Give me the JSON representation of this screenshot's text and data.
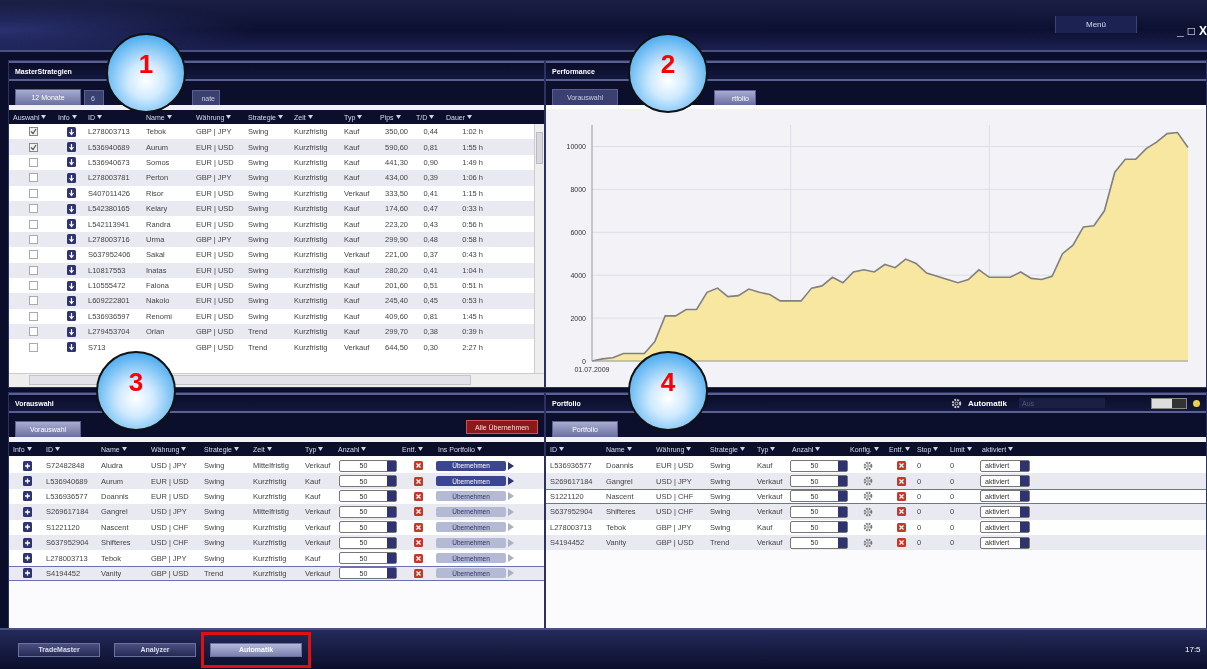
{
  "window": {
    "menu": "Menü",
    "controls": [
      "_",
      "□",
      "X"
    ]
  },
  "callouts": [
    "1",
    "2",
    "3",
    "4"
  ],
  "master": {
    "title": "MasterStrategien",
    "tabs": [
      {
        "label": "12 Monate",
        "selected": true
      },
      {
        "label": "6",
        "selected": false
      },
      {
        "label": "nate",
        "selected": false
      }
    ],
    "columns": [
      "Auswahl",
      "Info",
      "ID",
      "Name",
      "Währung",
      "Strategie",
      "Zeit",
      "Typ",
      "Pips",
      "T/D",
      "Dauer"
    ],
    "rows": [
      {
        "checked": true,
        "id": "L278003713",
        "name": "Tebok",
        "currency": "GBP | JPY",
        "strategy": "Swing",
        "term": "Kurzfristig",
        "type": "Kauf",
        "pips": "350,00",
        "td": "0,44",
        "duration": "1:02 h"
      },
      {
        "checked": true,
        "id": "L536940689",
        "name": "Aurum",
        "currency": "EUR | USD",
        "strategy": "Swing",
        "term": "Kurzfristig",
        "type": "Kauf",
        "pips": "590,60",
        "td": "0,81",
        "duration": "1:55 h"
      },
      {
        "checked": false,
        "id": "L536940673",
        "name": "Somos",
        "currency": "EUR | USD",
        "strategy": "Swing",
        "term": "Kurzfristig",
        "type": "Kauf",
        "pips": "441,30",
        "td": "0,90",
        "duration": "1:49 h"
      },
      {
        "checked": false,
        "id": "L278003781",
        "name": "Perton",
        "currency": "GBP | JPY",
        "strategy": "Swing",
        "term": "Kurzfristig",
        "type": "Kauf",
        "pips": "434,00",
        "td": "0,39",
        "duration": "1:06 h"
      },
      {
        "checked": false,
        "id": "S407011426",
        "name": "Risor",
        "currency": "EUR | USD",
        "strategy": "Swing",
        "term": "Kurzfristig",
        "type": "Verkauf",
        "pips": "333,50",
        "td": "0,41",
        "duration": "1:15 h"
      },
      {
        "checked": false,
        "id": "L542380165",
        "name": "Kelary",
        "currency": "EUR | USD",
        "strategy": "Swing",
        "term": "Kurzfristig",
        "type": "Kauf",
        "pips": "174,60",
        "td": "0,47",
        "duration": "0:33 h"
      },
      {
        "checked": false,
        "id": "L542113941",
        "name": "Randra",
        "currency": "EUR | USD",
        "strategy": "Swing",
        "term": "Kurzfristig",
        "type": "Kauf",
        "pips": "223,20",
        "td": "0,43",
        "duration": "0:56 h"
      },
      {
        "checked": false,
        "id": "L278003716",
        "name": "Urma",
        "currency": "GBP | JPY",
        "strategy": "Swing",
        "term": "Kurzfristig",
        "type": "Kauf",
        "pips": "299,90",
        "td": "0,48",
        "duration": "0:58 h"
      },
      {
        "checked": false,
        "id": "S637952406",
        "name": "Sakal",
        "currency": "EUR | USD",
        "strategy": "Swing",
        "term": "Kurzfristig",
        "type": "Verkauf",
        "pips": "221,00",
        "td": "0,37",
        "duration": "0:43 h"
      },
      {
        "checked": false,
        "id": "L10817553",
        "name": "Inatas",
        "currency": "EUR | USD",
        "strategy": "Swing",
        "term": "Kurzfristig",
        "type": "Kauf",
        "pips": "280,20",
        "td": "0,41",
        "duration": "1:04 h"
      },
      {
        "checked": false,
        "id": "L10555472",
        "name": "Falona",
        "currency": "EUR | USD",
        "strategy": "Swing",
        "term": "Kurzfristig",
        "type": "Kauf",
        "pips": "201,60",
        "td": "0,51",
        "duration": "0:51 h"
      },
      {
        "checked": false,
        "id": "L609222801",
        "name": "Nakolo",
        "currency": "EUR | USD",
        "strategy": "Swing",
        "term": "Kurzfristig",
        "type": "Kauf",
        "pips": "245,40",
        "td": "0,45",
        "duration": "0:53 h"
      },
      {
        "checked": false,
        "id": "L536936597",
        "name": "Renomi",
        "currency": "EUR | USD",
        "strategy": "Swing",
        "term": "Kurzfristig",
        "type": "Kauf",
        "pips": "409,60",
        "td": "0,81",
        "duration": "1:45 h"
      },
      {
        "checked": false,
        "id": "L279453704",
        "name": "Orlan",
        "currency": "GBP | USD",
        "strategy": "Trend",
        "term": "Kurzfristig",
        "type": "Kauf",
        "pips": "299,70",
        "td": "0,38",
        "duration": "0:39 h"
      },
      {
        "checked": false,
        "id": "S713",
        "currency": "GBP | USD",
        "strategy": "Trend",
        "term": "Kurzfristig",
        "type": "Verkauf",
        "pips": "644,50",
        "td": "0,30",
        "duration": "2:27 h"
      }
    ]
  },
  "performance": {
    "title": "Performance",
    "tabs": [
      {
        "label": "Vorauswahl",
        "selected": false
      },
      {
        "label": "rtfolio",
        "selected": true
      }
    ],
    "chart_data": {
      "type": "area",
      "grid": true,
      "ylim": [
        0,
        11000
      ],
      "yticks": [
        0,
        2000,
        4000,
        6000,
        8000,
        10000
      ],
      "categories": [
        "01.07.2009",
        null,
        null,
        null,
        null,
        null,
        null,
        null,
        null,
        null,
        null,
        null,
        null,
        null,
        null,
        null,
        null,
        null,
        null,
        null,
        null,
        null,
        null,
        null,
        null,
        null,
        null,
        null,
        null,
        null,
        null,
        null,
        null,
        null,
        null,
        null,
        null,
        null,
        null,
        null,
        null,
        null,
        null,
        null,
        null,
        null,
        null,
        null,
        null,
        null,
        null,
        null,
        null,
        null,
        null,
        null,
        null,
        null
      ],
      "series": [
        {
          "color": "#f7e7a0",
          "values": [
            0,
            100,
            150,
            350,
            350,
            350,
            900,
            2100,
            2100,
            2400,
            2400,
            3200,
            3400,
            3000,
            3050,
            3350,
            3200,
            3100,
            2800,
            2800,
            2800,
            3400,
            3500,
            3900,
            3650,
            4150,
            4250,
            4150,
            4500,
            4350,
            4750,
            4550,
            4100,
            3950,
            3800,
            3650,
            3800,
            4250,
            3900,
            3900,
            3900,
            4150,
            3850,
            3800,
            3950,
            5000,
            5400,
            6250,
            6300,
            7000,
            8800,
            9400,
            9400,
            9900,
            10200,
            10600,
            10650,
            9950
          ]
        }
      ]
    }
  },
  "preselection": {
    "title": "Vorauswahl",
    "tabs": [
      {
        "label": "Vorauswahl",
        "selected": true
      }
    ],
    "accept_all": "Alle Übernehmen",
    "columns": [
      "Info",
      "ID",
      "Name",
      "Währung",
      "Strategie",
      "Zeit",
      "Typ",
      "Anzahl",
      "Entf.",
      "Ins Portfolio"
    ],
    "rows": [
      {
        "selected": false,
        "enabled": true,
        "id": "S72482848",
        "name": "Aludra",
        "currency": "USD | JPY",
        "strategy": "Swing",
        "term": "Mittelfristig",
        "type": "Verkauf",
        "quantity": "50",
        "button": "Übernehmen"
      },
      {
        "selected": false,
        "enabled": true,
        "id": "L536940689",
        "name": "Aurum",
        "currency": "EUR | USD",
        "strategy": "Swing",
        "term": "Kurzfristig",
        "type": "Kauf",
        "quantity": "50",
        "button": "Übernehmen"
      },
      {
        "selected": false,
        "enabled": false,
        "id": "L536936577",
        "name": "Doannis",
        "currency": "EUR | USD",
        "strategy": "Swing",
        "term": "Kurzfristig",
        "type": "Kauf",
        "quantity": "50",
        "button": "Übernehmen"
      },
      {
        "selected": false,
        "enabled": false,
        "id": "S269617184",
        "name": "Gangrel",
        "currency": "USD | JPY",
        "strategy": "Swing",
        "term": "Mittelfristig",
        "type": "Verkauf",
        "quantity": "50",
        "button": "Übernehmen"
      },
      {
        "selected": false,
        "enabled": false,
        "id": "S1221120",
        "name": "Nascent",
        "currency": "USD | CHF",
        "strategy": "Swing",
        "term": "Kurzfristig",
        "type": "Verkauf",
        "quantity": "50",
        "button": "Übernehmen"
      },
      {
        "selected": false,
        "enabled": false,
        "id": "S637952904",
        "name": "Shifteres",
        "currency": "USD | CHF",
        "strategy": "Swing",
        "term": "Kurzfristig",
        "type": "Verkauf",
        "quantity": "50",
        "button": "Übernehmen"
      },
      {
        "selected": false,
        "enabled": false,
        "id": "L278003713",
        "name": "Tebok",
        "currency": "GBP | JPY",
        "strategy": "Swing",
        "term": "Kurzfristig",
        "type": "Kauf",
        "quantity": "50",
        "button": "Übernehmen"
      },
      {
        "selected": true,
        "enabled": false,
        "id": "S4194452",
        "name": "Vanity",
        "currency": "GBP | USD",
        "strategy": "Trend",
        "term": "Kurzfristig",
        "type": "Verkauf",
        "quantity": "50",
        "button": "Übernehmen"
      }
    ]
  },
  "portfolio": {
    "title": "Portfolio",
    "automation_label": "Automatik",
    "automation_field": {
      "placeholder": "Aus"
    },
    "automation_toggle": {
      "on": true
    },
    "tabs": [
      {
        "label": "Portfolio",
        "selected": true
      }
    ],
    "columns": [
      "ID",
      "Name",
      "Währung",
      "Strategie",
      "Typ",
      "Anzahl",
      "Konfig.",
      "Entf.",
      "Stop",
      "Limit",
      "aktiviert"
    ],
    "rows": [
      {
        "selected": false,
        "id": "L536936577",
        "name": "Doannis",
        "currency": "EUR | USD",
        "strategy": "Swing",
        "type": "Kauf",
        "quantity": "50",
        "stop": "0",
        "limit": "0",
        "activation": "aktiviert"
      },
      {
        "selected": false,
        "id": "S269617184",
        "name": "Gangrel",
        "currency": "USD | JPY",
        "strategy": "Swing",
        "type": "Verkauf",
        "quantity": "50",
        "stop": "0",
        "limit": "0",
        "activation": "aktiviert"
      },
      {
        "selected": true,
        "id": "S1221120",
        "name": "Nascent",
        "currency": "USD | CHF",
        "strategy": "Swing",
        "type": "Verkauf",
        "quantity": "50",
        "stop": "0",
        "limit": "0",
        "activation": "aktiviert"
      },
      {
        "selected": false,
        "id": "S637952904",
        "name": "Shifteres",
        "currency": "USD | CHF",
        "strategy": "Swing",
        "type": "Verkauf",
        "quantity": "50",
        "stop": "0",
        "limit": "0",
        "activation": "aktiviert"
      },
      {
        "selected": false,
        "id": "L278003713",
        "name": "Tebok",
        "currency": "GBP | JPY",
        "strategy": "Swing",
        "type": "Kauf",
        "quantity": "50",
        "stop": "0",
        "limit": "0",
        "activation": "aktiviert"
      },
      {
        "selected": false,
        "id": "S4194452",
        "name": "Vanity",
        "currency": "GBP | USD",
        "strategy": "Trend",
        "type": "Verkauf",
        "quantity": "50",
        "stop": "0",
        "limit": "0",
        "activation": "aktiviert"
      }
    ]
  },
  "taskbar": {
    "buttons": [
      {
        "label": "TradeMaster",
        "selected": false,
        "highlighted": false
      },
      {
        "label": "Analyzer",
        "selected": false,
        "highlighted": false
      },
      {
        "label": "Automatik",
        "selected": true,
        "highlighted": true
      }
    ],
    "clock": "17:5"
  }
}
